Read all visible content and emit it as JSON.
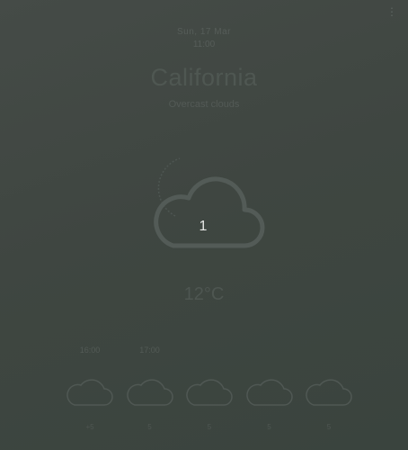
{
  "menu": {
    "icon": "more-vert-icon",
    "glyph": "⋮"
  },
  "header": {
    "date": "Sun, 17 Mar",
    "time": "11:00",
    "city": "California",
    "condition": "Overcast clouds"
  },
  "current": {
    "icon": "cloud-icon",
    "icon_number": "1",
    "temperature": "12°C"
  },
  "forecast": [
    {
      "time": "16:00",
      "icon": "cloud-icon",
      "temp": "+5"
    },
    {
      "time": "17:00",
      "icon": "cloud-icon",
      "temp": "5"
    },
    {
      "time": "",
      "icon": "cloud-icon",
      "temp": "5"
    },
    {
      "time": "",
      "icon": "cloud-icon",
      "temp": "5"
    },
    {
      "time": "",
      "icon": "cloud-icon",
      "temp": "5"
    }
  ],
  "colors": {
    "background": "#3f4641",
    "icon_stroke": "#535b57",
    "icon_number": "#e6e8e6"
  }
}
